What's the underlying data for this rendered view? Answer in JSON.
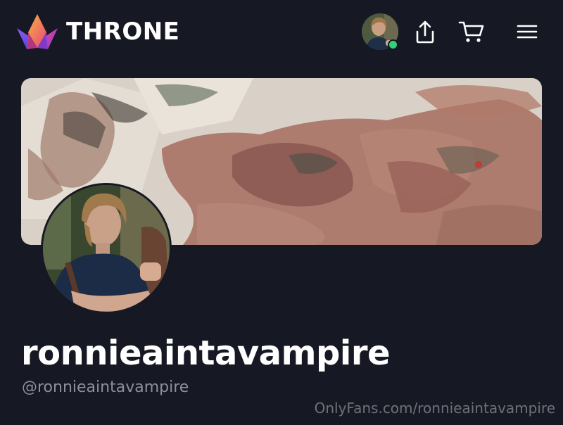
{
  "header": {
    "brand": "THRONE",
    "logo_icon": "throne-crown-logo-icon",
    "user_status": "online",
    "actions": [
      {
        "name": "share",
        "icon": "share-icon"
      },
      {
        "name": "cart",
        "icon": "cart-icon"
      },
      {
        "name": "menu",
        "icon": "hamburger-menu-icon"
      }
    ]
  },
  "profile": {
    "display_name": "ronnieaintavampire",
    "handle": "@ronnieaintavampire"
  },
  "watermark": "OnlyFans.com/ronnieaintavampire",
  "colors": {
    "background": "#161923",
    "online": "#33d17a",
    "handle_text": "#8b909b",
    "logo_gradient": [
      "#f7a23b",
      "#e9447f",
      "#7b3ff2"
    ]
  }
}
